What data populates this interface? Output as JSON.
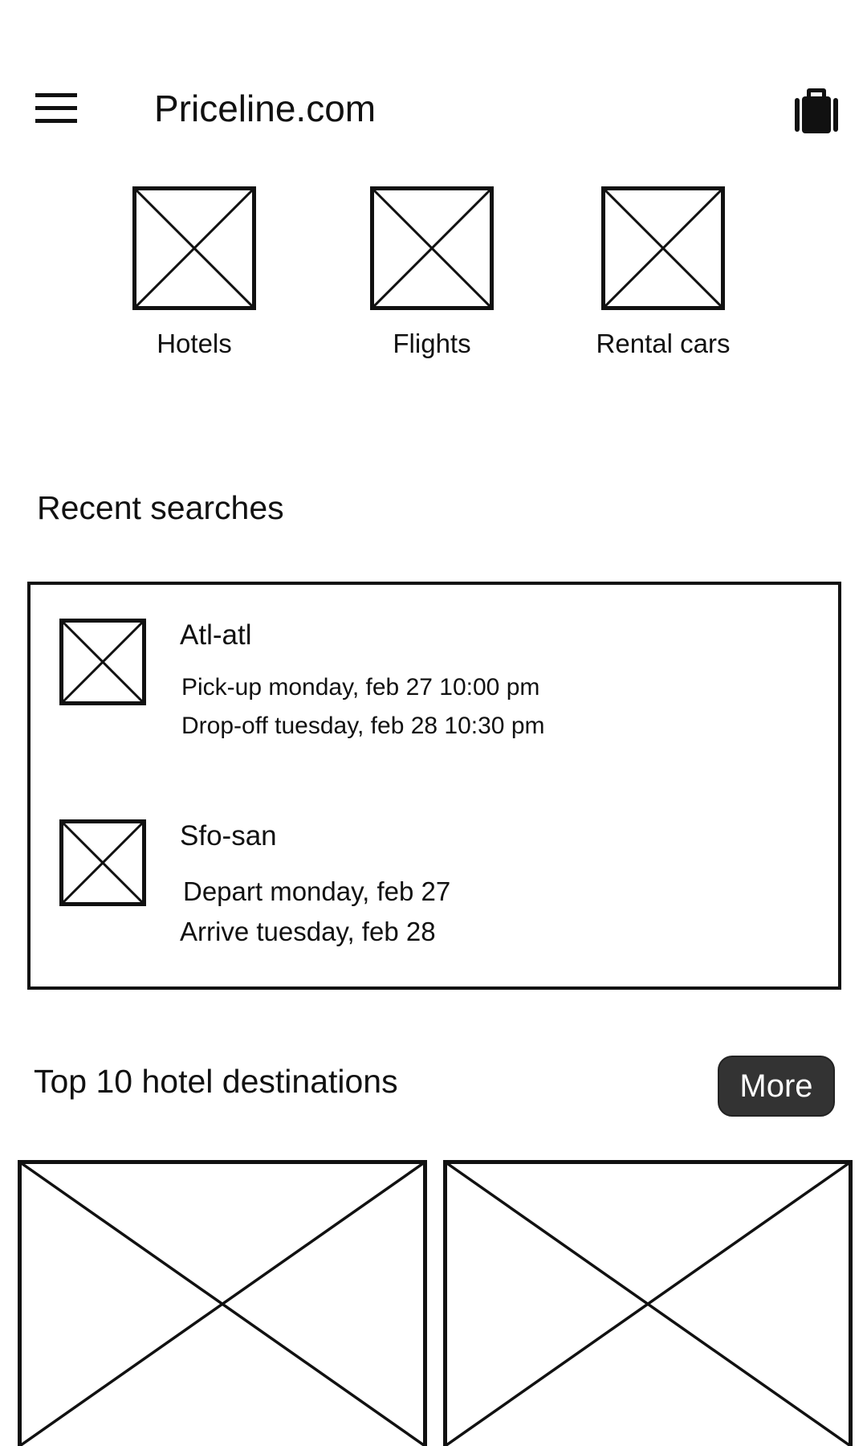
{
  "header": {
    "title": "Priceline.com",
    "menu_icon": "hamburger-menu-icon",
    "trips_icon": "luggage-icon"
  },
  "categories": [
    {
      "label": "Hotels",
      "icon": "image-placeholder-icon"
    },
    {
      "label": "Flights",
      "icon": "image-placeholder-icon"
    },
    {
      "label": "Rental cars",
      "icon": "image-placeholder-icon"
    }
  ],
  "recent": {
    "title": "Recent searches",
    "items": [
      {
        "route": "Atl-atl",
        "line1": "Pick-up monday, feb 27 10:00 pm",
        "line2": "Drop-off tuesday, feb 28 10:30 pm"
      },
      {
        "route": "Sfo-san",
        "line1": "Depart monday, feb 27",
        "line2": "Arrive tuesday, feb 28"
      }
    ]
  },
  "top_destinations": {
    "title": "Top 10 hotel destinations",
    "more_label": "More"
  },
  "colors": {
    "stroke": "#111111",
    "button_bg": "#333333",
    "button_text": "#ffffff",
    "background": "#ffffff"
  }
}
